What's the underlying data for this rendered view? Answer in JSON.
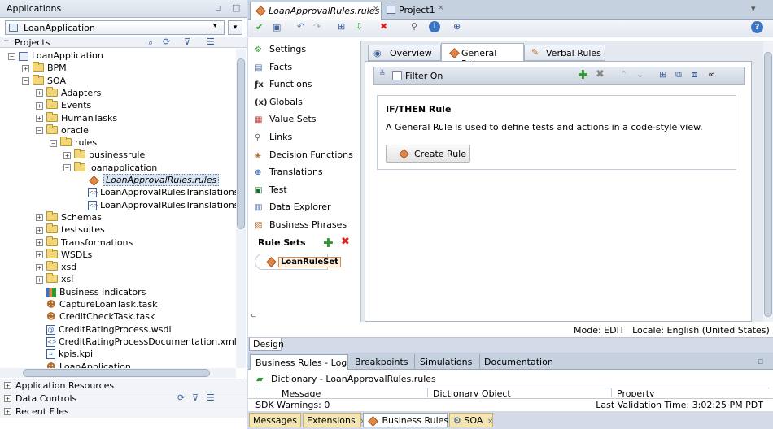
{
  "left_panel": {
    "title": "Applications",
    "app_selector": "LoanApplication",
    "projects_label": "Projects",
    "tree": [
      {
        "label": "LoanApplication",
        "indent": 0,
        "type": "project"
      },
      {
        "label": "BPM",
        "indent": 1,
        "type": "folder"
      },
      {
        "label": "SOA",
        "indent": 1,
        "type": "folder"
      },
      {
        "label": "Adapters",
        "indent": 2,
        "type": "folder"
      },
      {
        "label": "Events",
        "indent": 2,
        "type": "folder"
      },
      {
        "label": "HumanTasks",
        "indent": 2,
        "type": "folder"
      },
      {
        "label": "oracle",
        "indent": 2,
        "type": "folder"
      },
      {
        "label": "rules",
        "indent": 3,
        "type": "folder"
      },
      {
        "label": "businessrule",
        "indent": 4,
        "type": "folder"
      },
      {
        "label": "loanapplication",
        "indent": 4,
        "type": "folder"
      },
      {
        "label": "LoanApprovalRules.rules",
        "indent": 5,
        "type": "rules"
      },
      {
        "label": "LoanApprovalRulesTranslations.",
        "indent": 5,
        "type": "xml"
      },
      {
        "label": "LoanApprovalRulesTranslations.",
        "indent": 5,
        "type": "xml"
      },
      {
        "label": "Schemas",
        "indent": 2,
        "type": "folder"
      },
      {
        "label": "testsuites",
        "indent": 2,
        "type": "folder"
      },
      {
        "label": "Transformations",
        "indent": 2,
        "type": "folder"
      },
      {
        "label": "WSDLs",
        "indent": 2,
        "type": "folder"
      },
      {
        "label": "xsd",
        "indent": 2,
        "type": "folder"
      },
      {
        "label": "xsl",
        "indent": 2,
        "type": "folder"
      },
      {
        "label": "Business Indicators",
        "indent": 2,
        "type": "bi"
      },
      {
        "label": "CaptureLoanTask.task",
        "indent": 2,
        "type": "task"
      },
      {
        "label": "CreditCheckTask.task",
        "indent": 2,
        "type": "task"
      },
      {
        "label": "CreditRatingProcess.wsdl",
        "indent": 2,
        "type": "wsdl"
      },
      {
        "label": "CreditRatingProcessDocumentation.xml",
        "indent": 2,
        "type": "xml"
      },
      {
        "label": "kpis.kpi",
        "indent": 2,
        "type": "kpi"
      },
      {
        "label": "LoanApplication",
        "indent": 2,
        "type": "task"
      }
    ],
    "sections": [
      "Application Resources",
      "Data Controls",
      "Recent Files"
    ]
  },
  "editor": {
    "tabs": [
      {
        "label": "LoanApprovalRules.rules"
      },
      {
        "label": "Project1"
      }
    ],
    "nav_items": [
      {
        "label": "Settings"
      },
      {
        "label": "Facts"
      },
      {
        "label": "Functions"
      },
      {
        "label": "Globals"
      },
      {
        "label": "Value Sets"
      },
      {
        "label": "Links"
      },
      {
        "label": "Decision Functions"
      },
      {
        "label": "Translations"
      },
      {
        "label": "Test"
      },
      {
        "label": "Data Explorer"
      },
      {
        "label": "Business Phrases"
      }
    ],
    "rule_sets_label": "Rule Sets",
    "rule_set": "LoanRuleSet",
    "rule_tabs": [
      {
        "label": "Overview"
      },
      {
        "label": "General Rules"
      },
      {
        "label": "Verbal Rules"
      }
    ],
    "filter_label": "Filter On",
    "card_title": "IF/THEN Rule",
    "card_text": "A General Rule is used to define tests and actions in a code-style view.",
    "create_button": "Create Rule",
    "status_mode": "Mode: EDIT",
    "status_locale": "Locale: English (United States)",
    "design_tab": "Design"
  },
  "log_panel": {
    "tabs": [
      "Business Rules - Log",
      "Breakpoints",
      "Simulations",
      "Documentation"
    ],
    "dictionary": "Dictionary - LoanApprovalRules.rules",
    "columns": [
      "Message",
      "Dictionary Object",
      "Property"
    ],
    "sdk_warnings": "SDK Warnings: 0",
    "last_validation": "Last Validation Time: 3:02:25 PM PDT"
  },
  "bottom_tabs": [
    {
      "label": "Messages"
    },
    {
      "label": "Extensions"
    },
    {
      "label": "Business Rules"
    },
    {
      "label": "SOA"
    }
  ],
  "colors": {
    "bg": "#d4dbe6",
    "selected": "#d9e4f3",
    "accent_orange": "#e0884a",
    "add_green": "#2f9a2f",
    "delete_red": "#d22"
  }
}
